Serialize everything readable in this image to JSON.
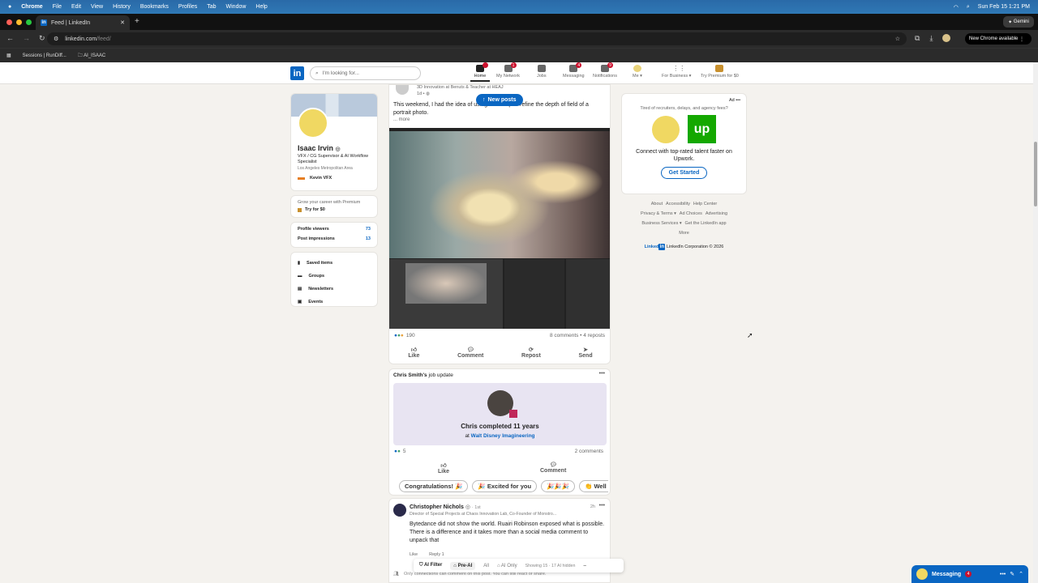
{
  "menubar": {
    "app": "Chrome",
    "items": [
      "File",
      "Edit",
      "View",
      "History",
      "Bookmarks",
      "Profiles",
      "Tab",
      "Window",
      "Help"
    ],
    "datetime": "Sun Feb 15  1:21 PM"
  },
  "browser": {
    "tab_title": "Feed | LinkedIn",
    "url_host": "linkedin.com",
    "url_path": "/feed/",
    "gemini": "Gemini",
    "new_chrome": "New Chrome available",
    "bookmarks": [
      "Sessions | RunDiff...",
      "AI_ISAAC"
    ]
  },
  "header": {
    "search_placeholder": "I'm looking for...",
    "nav": [
      {
        "label": "Home",
        "badge": ""
      },
      {
        "label": "My Network",
        "badge": "1"
      },
      {
        "label": "Jobs",
        "badge": ""
      },
      {
        "label": "Messaging",
        "badge": "4"
      },
      {
        "label": "Notifications",
        "badge": "9"
      },
      {
        "label": "Me ▾",
        "badge": ""
      },
      {
        "label": "For Business ▾",
        "badge": ""
      },
      {
        "label": "Try Premium for $0",
        "badge": ""
      }
    ]
  },
  "profile": {
    "name": "Isaac Irvin",
    "headline": "VFX / CG Supervisor & AI Workflow Specialist",
    "location": "Los Angeles Metropolitan Area",
    "company": "Kevin VFX",
    "premium_text": "Grow your career with Premium",
    "premium_cta": "Try for $0",
    "stats": [
      {
        "label": "Profile viewers",
        "value": "73"
      },
      {
        "label": "Post impressions",
        "value": "13"
      }
    ],
    "links": [
      "Saved items",
      "Groups",
      "Newsletters",
      "Events"
    ]
  },
  "post1": {
    "author_sub": "3D Innovation at Benuts & Teacher at HEAJ",
    "time": "1d •",
    "text": "This weekend, I had the idea of using ml-Sharp to refine the depth of field of a portrait photo.",
    "more": "... more",
    "reactions": "190",
    "comments": "8 comments • 4 reposts",
    "actions": [
      "Like",
      "Comment",
      "Repost",
      "Send"
    ]
  },
  "new_posts": "New posts",
  "post2": {
    "author": "Chris Smith's",
    "kind": "job update",
    "headline": "Chris completed 11 years",
    "at": "at",
    "company": "Walt Disney Imagineering",
    "reactions": "5",
    "comments": "2 comments",
    "actions": [
      "Like",
      "Comment"
    ],
    "suggestions": [
      "Congratulations! 🎉",
      "🎉 Excited for you",
      "🎉🎉🎉",
      "👏 Well do"
    ]
  },
  "comment": {
    "author": "Christopher Nichols",
    "degree": "· 1st",
    "headline": "Director of Special Projects at Chaos Innovation Lab, Co-Founder of Monstro...",
    "time": "2h",
    "text": "Bytedance did not show the world. Ruairi Robinson exposed what is possible. There is a difference and it takes more than a social media comment to unpack that",
    "like": "Like",
    "reply": "Reply 1",
    "footer": "Only connections can comment on this post. You can still react or share."
  },
  "filterbar": {
    "ai_filter": "AI Filter",
    "pre_ai": "Pre-AI",
    "all": "All",
    "ai_only": "AI Only",
    "status": "Showing 15 · 17 AI hidden",
    "collapse": "–"
  },
  "ad": {
    "label": "Ad",
    "tagline": "Tired of recruiters, delays, and agency fees?",
    "text": "Connect with top-rated talent faster on Upwork.",
    "cta": "Get Started",
    "logo": "up"
  },
  "footer": {
    "links": [
      "About",
      "Accessibility",
      "Help Center",
      "Privacy & Terms ▾",
      "Ad Choices",
      "Advertising",
      "Business Services ▾",
      "Get the LinkedIn app",
      "More"
    ],
    "brand": "Linked",
    "copyright": "LinkedIn Corporation © 2026"
  },
  "messaging": {
    "label": "Messaging",
    "badge": "4"
  },
  "colors": {
    "brand": "#0a66c2",
    "badge": "#cb112d",
    "upwork": "#14a800"
  }
}
